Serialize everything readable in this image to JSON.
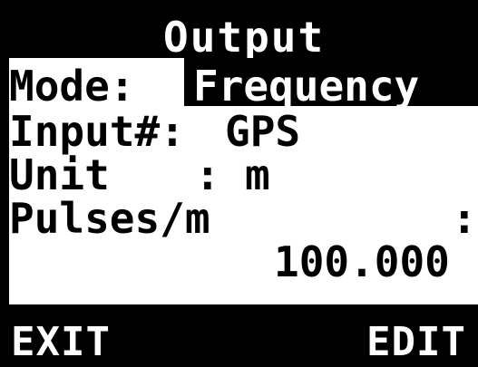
{
  "screen": {
    "title": "Output",
    "mode_label": "Mode:",
    "mode_value": "Frequency",
    "input_label": "Input#:",
    "input_value": "GPS",
    "unit_label": "Unit",
    "unit_sep": ":",
    "unit_value": "m",
    "pulses_label": "Pulses/m",
    "pulses_sep": ":",
    "pulses_value": "100.000"
  },
  "softkeys": {
    "left": "EXIT",
    "right": "EDIT"
  },
  "colors": {
    "foreground": "#000000",
    "background": "#ffffff"
  }
}
